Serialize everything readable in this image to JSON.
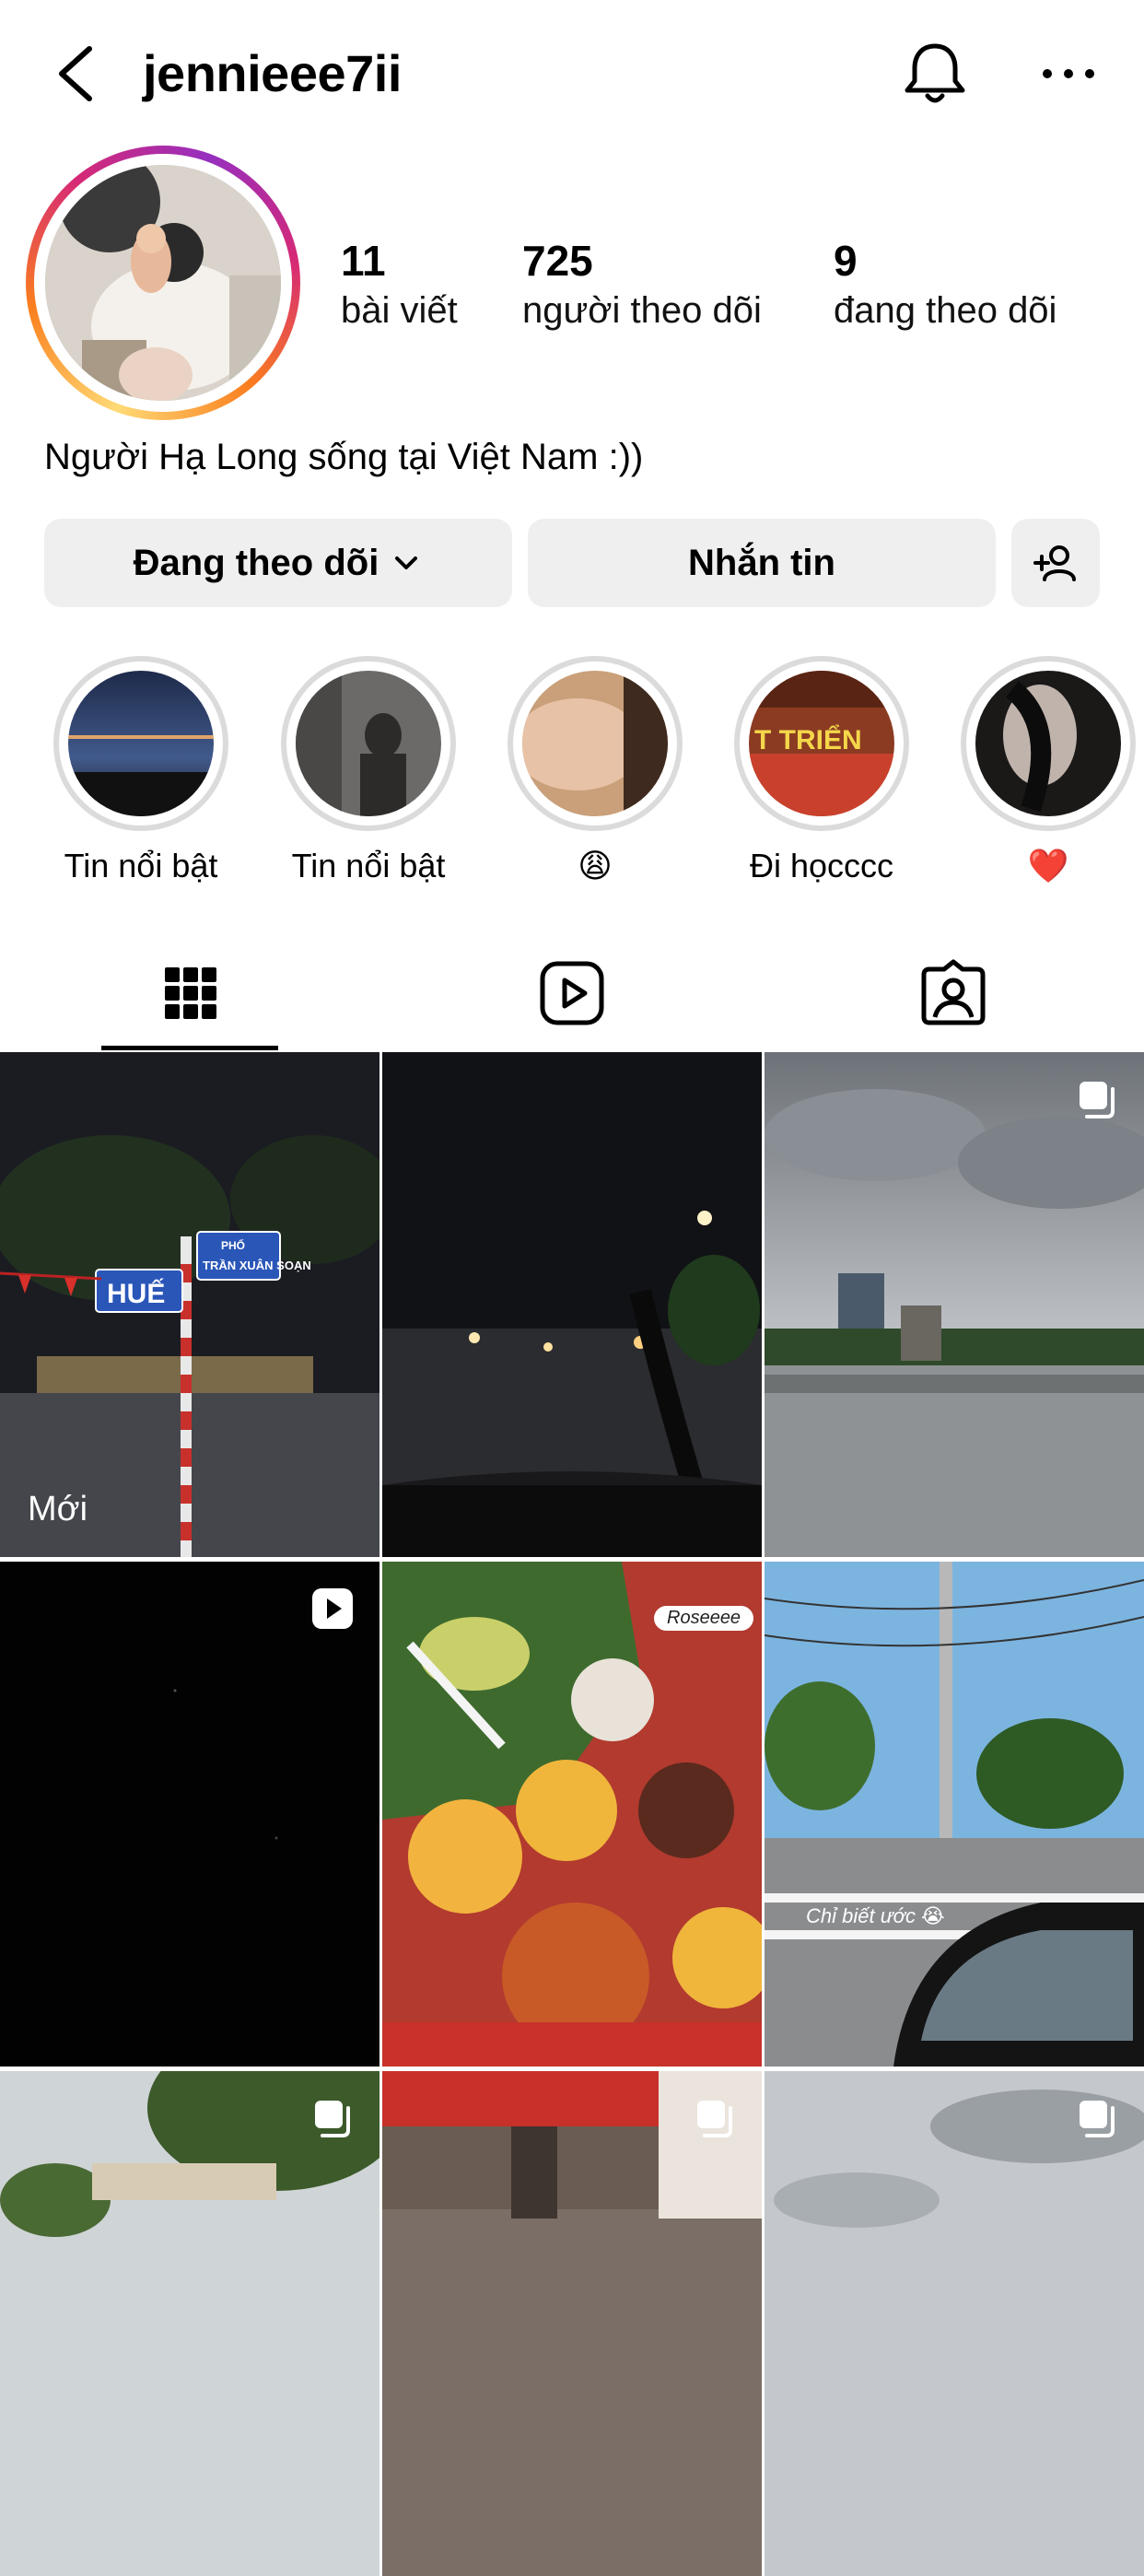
{
  "header": {
    "username": "jennieee7ii",
    "icons": {
      "back": "chevron-left-icon",
      "bell": "bell-icon",
      "more": "more-horizontal-icon"
    }
  },
  "profile": {
    "stats": [
      {
        "value": "11",
        "label": "bài viết"
      },
      {
        "value": "725",
        "label": "người theo dõi"
      },
      {
        "value": "9",
        "label": "đang theo dõi"
      }
    ],
    "bio": "Người Hạ Long sống tại Việt Nam :))"
  },
  "actions": {
    "follow_label": "Đang theo dõi",
    "message_label": "Nhắn tin",
    "add_icon": "add-person-icon"
  },
  "highlights": [
    {
      "label": "Tin nổi bật"
    },
    {
      "label": "Tin nổi bật"
    },
    {
      "label": "😩"
    },
    {
      "label": "Đi họcccc",
      "image_text": "T TRIỂN"
    },
    {
      "label": "❤️"
    }
  ],
  "tabs": [
    {
      "name": "grid",
      "icon": "grid-icon",
      "active": true
    },
    {
      "name": "reels",
      "icon": "reels-icon",
      "active": false
    },
    {
      "name": "tagged",
      "icon": "tagged-person-icon",
      "active": false
    }
  ],
  "posts": [
    {
      "badge": "",
      "label": "Mới",
      "sign_top": "PHỐ",
      "sign_bottom": "TRẦN XUÂN SOẠN",
      "sign_main": "HUẾ"
    },
    {
      "badge": ""
    },
    {
      "badge": "carousel-icon"
    },
    {
      "badge": "reel-icon"
    },
    {
      "badge": "",
      "chip": "Roseeee"
    },
    {
      "badge": "",
      "caption": "Chỉ biết ước 😭"
    },
    {
      "badge": "carousel-icon"
    },
    {
      "badge": "carousel-icon"
    },
    {
      "badge": "carousel-icon"
    }
  ],
  "colors": {
    "button_bg": "#efefef",
    "ring_neutral": "#dbdbdb",
    "story_gradient": [
      "#feda75",
      "#fa7e1e",
      "#d62976",
      "#962fbf"
    ]
  }
}
